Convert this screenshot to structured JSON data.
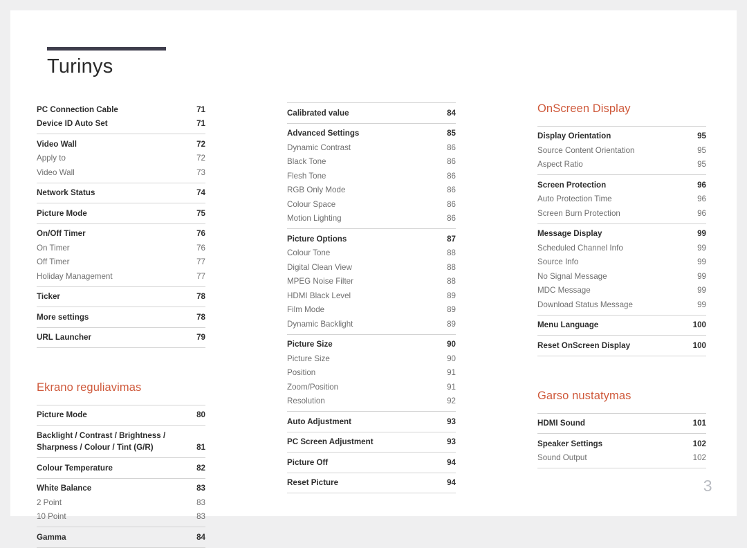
{
  "document": {
    "title": "Turinys",
    "folio": "3",
    "accent_color": "#cf5a3c",
    "rule_color": "#3e3d4c"
  },
  "columns": [
    {
      "id": "column-1",
      "blocks": [
        {
          "type": "group",
          "first": true,
          "rows": [
            {
              "level": "main",
              "label": "PC Connection Cable",
              "page": "71"
            },
            {
              "level": "main",
              "label": "Device ID Auto Set",
              "page": "71"
            }
          ]
        },
        {
          "type": "group",
          "rows": [
            {
              "level": "main",
              "label": "Video Wall",
              "page": "72"
            },
            {
              "level": "sub",
              "label": "Apply to",
              "page": "72"
            },
            {
              "level": "sub",
              "label": "Video Wall",
              "page": "73"
            }
          ]
        },
        {
          "type": "group",
          "rows": [
            {
              "level": "main",
              "label": "Network Status",
              "page": "74"
            }
          ]
        },
        {
          "type": "group",
          "rows": [
            {
              "level": "main",
              "label": "Picture Mode",
              "page": "75"
            }
          ]
        },
        {
          "type": "group",
          "rows": [
            {
              "level": "main",
              "label": "On/Off Timer",
              "page": "76"
            },
            {
              "level": "sub",
              "label": "On Timer",
              "page": "76"
            },
            {
              "level": "sub",
              "label": "Off Timer",
              "page": "77"
            },
            {
              "level": "sub",
              "label": "Holiday Management",
              "page": "77"
            }
          ]
        },
        {
          "type": "group",
          "rows": [
            {
              "level": "main",
              "label": "Ticker",
              "page": "78"
            }
          ]
        },
        {
          "type": "group",
          "rows": [
            {
              "level": "main",
              "label": "More settings",
              "page": "78"
            }
          ]
        },
        {
          "type": "group",
          "last_rule": true,
          "rows": [
            {
              "level": "main",
              "label": "URL Launcher",
              "page": "79"
            }
          ]
        },
        {
          "type": "heading",
          "label": "Ekrano reguliavimas"
        },
        {
          "type": "group",
          "rows": [
            {
              "level": "main",
              "label": "Picture Mode",
              "page": "80"
            }
          ]
        },
        {
          "type": "group",
          "rows": [
            {
              "level": "main",
              "multiline": true,
              "label": "Backlight / Contrast / Brightness /\nSharpness / Colour / Tint (G/R)",
              "page": "81"
            }
          ]
        },
        {
          "type": "group",
          "rows": [
            {
              "level": "main",
              "label": "Colour Temperature",
              "page": "82"
            }
          ]
        },
        {
          "type": "group",
          "rows": [
            {
              "level": "main",
              "label": "White Balance",
              "page": "83"
            },
            {
              "level": "sub",
              "label": "2 Point",
              "page": "83"
            },
            {
              "level": "sub",
              "label": "10 Point",
              "page": "83"
            }
          ]
        },
        {
          "type": "group",
          "last_rule": true,
          "rows": [
            {
              "level": "main",
              "label": "Gamma",
              "page": "84"
            }
          ]
        }
      ]
    },
    {
      "id": "column-2",
      "blocks": [
        {
          "type": "group",
          "first": true,
          "top_rule": true,
          "rows": [
            {
              "level": "main",
              "label": "Calibrated value",
              "page": "84"
            }
          ]
        },
        {
          "type": "group",
          "rows": [
            {
              "level": "main",
              "label": "Advanced Settings",
              "page": "85"
            },
            {
              "level": "sub",
              "label": "Dynamic Contrast",
              "page": "86"
            },
            {
              "level": "sub",
              "label": "Black Tone",
              "page": "86"
            },
            {
              "level": "sub",
              "label": "Flesh Tone",
              "page": "86"
            },
            {
              "level": "sub",
              "label": "RGB Only Mode",
              "page": "86"
            },
            {
              "level": "sub",
              "label": "Colour Space",
              "page": "86"
            },
            {
              "level": "sub",
              "label": "Motion Lighting",
              "page": "86"
            }
          ]
        },
        {
          "type": "group",
          "rows": [
            {
              "level": "main",
              "label": "Picture Options",
              "page": "87"
            },
            {
              "level": "sub",
              "label": "Colour Tone",
              "page": "88"
            },
            {
              "level": "sub",
              "label": "Digital Clean View",
              "page": "88"
            },
            {
              "level": "sub",
              "label": "MPEG Noise Filter",
              "page": "88"
            },
            {
              "level": "sub",
              "label": "HDMI Black Level",
              "page": "89"
            },
            {
              "level": "sub",
              "label": "Film Mode",
              "page": "89"
            },
            {
              "level": "sub",
              "label": "Dynamic Backlight",
              "page": "89"
            }
          ]
        },
        {
          "type": "group",
          "rows": [
            {
              "level": "main",
              "label": "Picture Size",
              "page": "90"
            },
            {
              "level": "sub",
              "label": "Picture Size",
              "page": "90"
            },
            {
              "level": "sub",
              "label": "Position",
              "page": "91"
            },
            {
              "level": "sub",
              "label": "Zoom/Position",
              "page": "91"
            },
            {
              "level": "sub",
              "label": "Resolution",
              "page": "92"
            }
          ]
        },
        {
          "type": "group",
          "rows": [
            {
              "level": "main",
              "label": "Auto Adjustment",
              "page": "93"
            }
          ]
        },
        {
          "type": "group",
          "rows": [
            {
              "level": "main",
              "label": "PC Screen Adjustment",
              "page": "93"
            }
          ]
        },
        {
          "type": "group",
          "rows": [
            {
              "level": "main",
              "label": "Picture Off",
              "page": "94"
            }
          ]
        },
        {
          "type": "group",
          "last_rule": true,
          "rows": [
            {
              "level": "main",
              "label": "Reset Picture",
              "page": "94"
            }
          ]
        }
      ]
    },
    {
      "id": "column-3",
      "blocks": [
        {
          "type": "heading",
          "first": true,
          "label": "OnScreen Display"
        },
        {
          "type": "group",
          "rows": [
            {
              "level": "main",
              "label": "Display Orientation",
              "page": "95"
            },
            {
              "level": "sub",
              "label": "Source Content Orientation",
              "page": "95"
            },
            {
              "level": "sub",
              "label": "Aspect Ratio",
              "page": "95"
            }
          ]
        },
        {
          "type": "group",
          "rows": [
            {
              "level": "main",
              "label": "Screen Protection",
              "page": "96"
            },
            {
              "level": "sub",
              "label": "Auto Protection Time",
              "page": "96"
            },
            {
              "level": "sub",
              "label": "Screen Burn Protection",
              "page": "96"
            }
          ]
        },
        {
          "type": "group",
          "rows": [
            {
              "level": "main",
              "label": "Message Display",
              "page": "99"
            },
            {
              "level": "sub",
              "label": "Scheduled Channel Info",
              "page": "99"
            },
            {
              "level": "sub",
              "label": "Source Info",
              "page": "99"
            },
            {
              "level": "sub",
              "label": "No Signal Message",
              "page": "99"
            },
            {
              "level": "sub",
              "label": "MDC Message",
              "page": "99"
            },
            {
              "level": "sub",
              "label": "Download Status Message",
              "page": "99"
            }
          ]
        },
        {
          "type": "group",
          "rows": [
            {
              "level": "main",
              "label": "Menu Language",
              "page": "100"
            }
          ]
        },
        {
          "type": "group",
          "last_rule": true,
          "rows": [
            {
              "level": "main",
              "label": "Reset OnScreen Display",
              "page": "100"
            }
          ]
        },
        {
          "type": "heading",
          "label": "Garso nustatymas"
        },
        {
          "type": "group",
          "rows": [
            {
              "level": "main",
              "label": "HDMI Sound",
              "page": "101"
            }
          ]
        },
        {
          "type": "group",
          "last_rule": true,
          "rows": [
            {
              "level": "main",
              "label": "Speaker Settings",
              "page": "102"
            },
            {
              "level": "sub",
              "label": "Sound Output",
              "page": "102"
            }
          ]
        }
      ]
    }
  ]
}
